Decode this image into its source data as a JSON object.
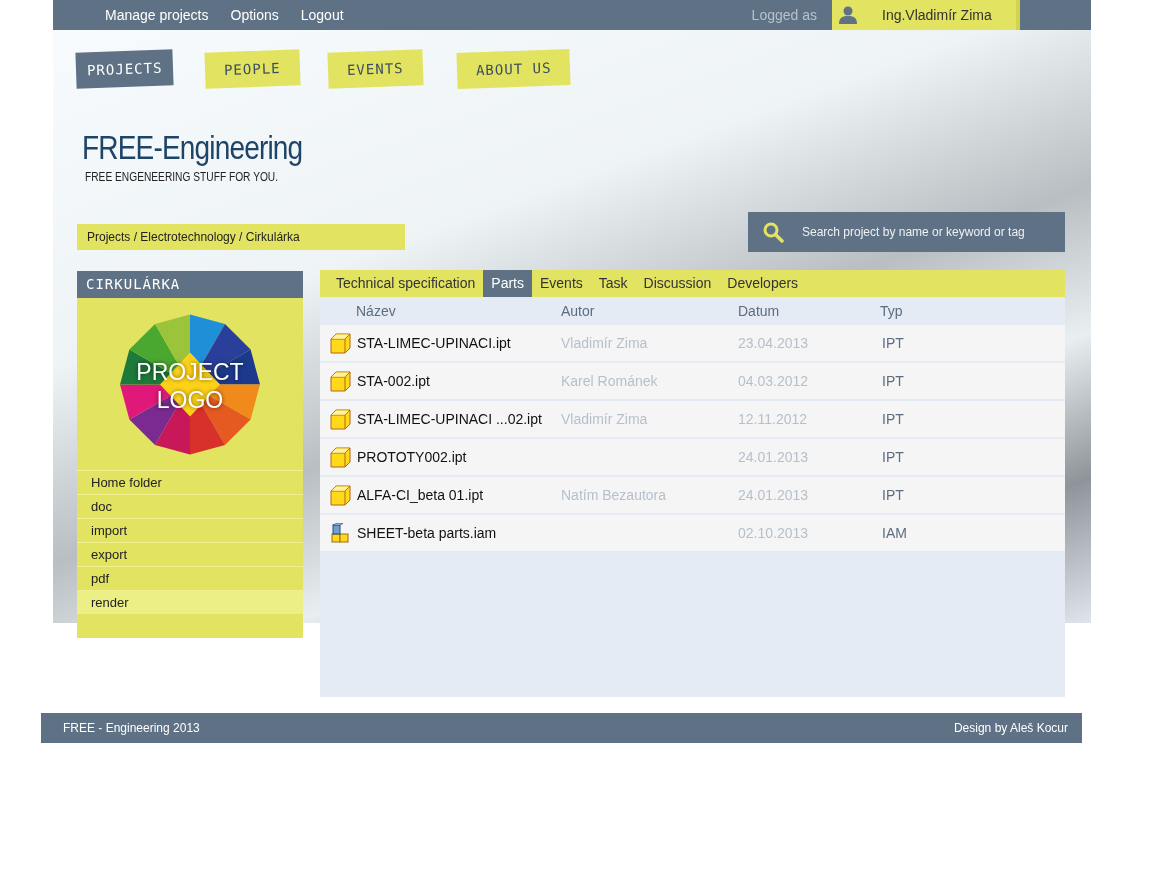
{
  "top_bar": {
    "links": [
      "Manage projects",
      "Options",
      "Logout"
    ],
    "logged_as": "Logged as",
    "user": "Ing.Vladimír Zima"
  },
  "nav_tabs": [
    {
      "label": "PROJECTS",
      "selected": true
    },
    {
      "label": "PEOPLE",
      "selected": false
    },
    {
      "label": "EVENTS",
      "selected": false
    },
    {
      "label": "ABOUT US",
      "selected": false
    }
  ],
  "site": {
    "title": "FREE-Engineering",
    "tagline": "FREE ENGENEERING STUFF FOR YOU."
  },
  "breadcrumb": "Projects / Electrotechnology / Cirkulárka",
  "search": {
    "placeholder": "Search project by name or keyword or tag"
  },
  "sidebar": {
    "title": "CIRKULÁRKA",
    "logo_text": [
      "PROJECT",
      "LOGO"
    ],
    "items": [
      {
        "label": "Home folder",
        "selected": false
      },
      {
        "label": "doc",
        "selected": false
      },
      {
        "label": "import",
        "selected": false
      },
      {
        "label": "export",
        "selected": false
      },
      {
        "label": "pdf",
        "selected": false
      },
      {
        "label": "render",
        "selected": true
      }
    ]
  },
  "content_tabs": [
    {
      "label": "Technical specification",
      "selected": false
    },
    {
      "label": "Parts",
      "selected": true
    },
    {
      "label": "Events",
      "selected": false
    },
    {
      "label": "Task",
      "selected": false
    },
    {
      "label": "Discussion",
      "selected": false
    },
    {
      "label": "Developers",
      "selected": false
    }
  ],
  "table": {
    "columns": [
      "Název",
      "Autor",
      "Datum",
      "Typ"
    ],
    "rows": [
      {
        "kind": "part",
        "name": "STA-LIMEC-UPINACI.ipt",
        "author": "Vladimír Zima",
        "date": "23.04.2013",
        "type": "IPT"
      },
      {
        "kind": "part",
        "name": "STA-002.ipt",
        "author": "Karel Románek",
        "date": "04.03.2012",
        "type": "IPT"
      },
      {
        "kind": "part",
        "name": "STA-LIMEC-UPINACI ...02.ipt",
        "author": "Vladimír Zima",
        "date": "12.11.2012",
        "type": "IPT"
      },
      {
        "kind": "part",
        "name": "PROTOTY002.ipt",
        "date": "24.01.2013",
        "type": "IPT"
      },
      {
        "kind": "part",
        "name": "ALFA-CI_beta 01.ipt",
        "author": "Natím Bezautora",
        "date": "24.01.2013",
        "type": "IPT"
      },
      {
        "kind": "assembly",
        "name": "SHEET-beta parts.iam",
        "date": "02.10.2013",
        "type": "IAM"
      }
    ]
  },
  "footer": {
    "left": "FREE - Engineering 2013",
    "right": "Design by Aleš Kocur"
  }
}
